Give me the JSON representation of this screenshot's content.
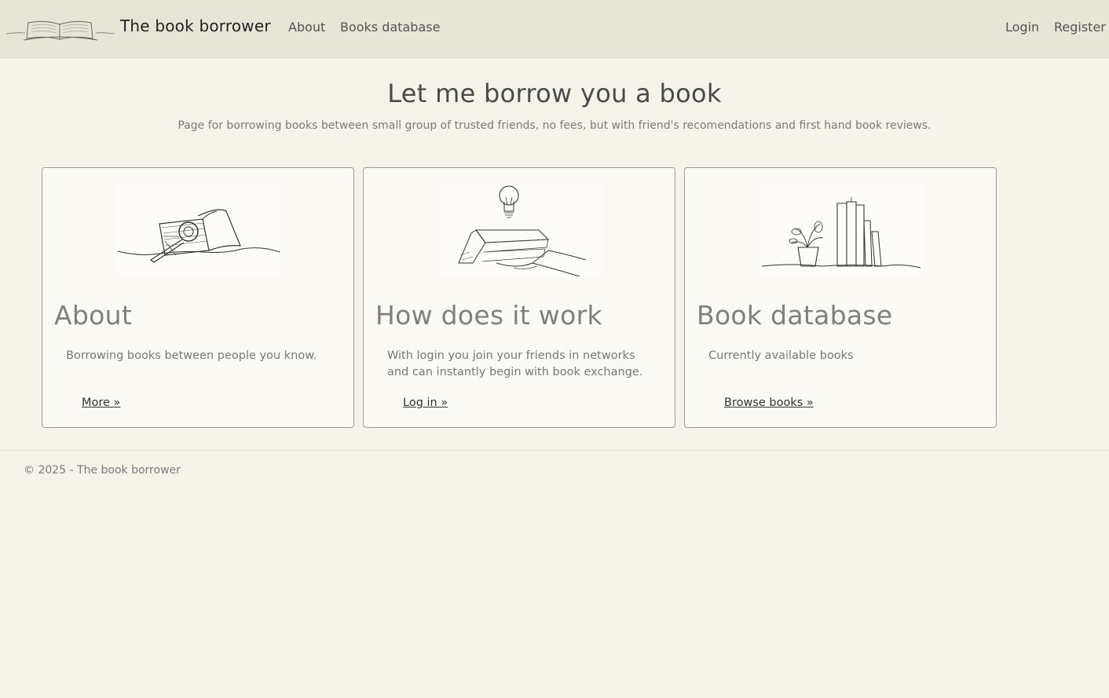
{
  "header": {
    "brand": "The book borrower",
    "nav": {
      "about": "About",
      "books_database": "Books database",
      "login": "Login",
      "register": "Register"
    }
  },
  "hero": {
    "title": "Let me borrow you a book",
    "subtitle": "Page for borrowing books between small group of trusted friends, no fees, but with friend's recomendations and first hand book reviews."
  },
  "cards": [
    {
      "title": "About",
      "text": "Borrowing books between people you know.",
      "link": "More »",
      "icon": "book-magnifier-illustration"
    },
    {
      "title": "How does it work",
      "text": "With login you join your friends in networks and can instantly begin with book exchange.",
      "link": "Log in »",
      "icon": "hand-book-lightbulb-illustration"
    },
    {
      "title": "Book database",
      "text": "Currently available books",
      "link": "Browse books »",
      "icon": "plant-bookshelf-illustration"
    }
  ],
  "footer": {
    "text": "© 2025 - The book borrower"
  },
  "colors": {
    "background": "#f6f3ea",
    "navbar": "#e7e4d8",
    "card": "#fcfaf5",
    "border": "#9b9b9b"
  }
}
